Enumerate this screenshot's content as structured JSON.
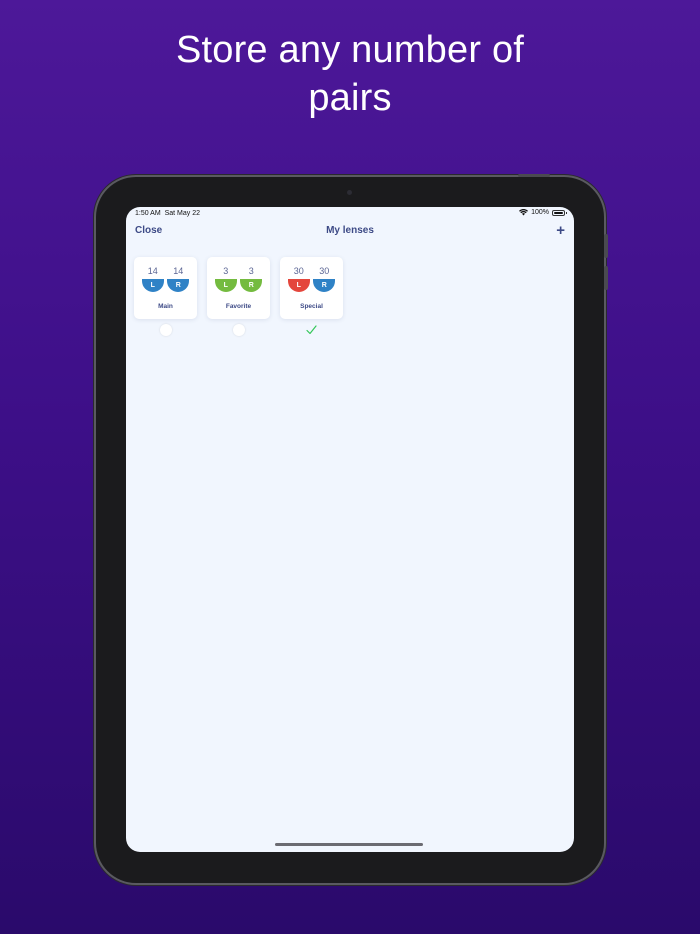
{
  "headline": {
    "line1": "Store any number of",
    "line2": "pairs"
  },
  "status_bar": {
    "time": "1:50 AM",
    "date": "Sat May 22",
    "battery": "100%",
    "wifi_icon": "wifi-icon",
    "battery_icon": "battery-icon"
  },
  "nav": {
    "close_label": "Close",
    "title": "My lenses",
    "add_label": "+"
  },
  "colors": {
    "blue_lens": "#2f82c6",
    "green_lens": "#74bb3f",
    "red_lens": "#e4463c",
    "text_navy": "#3d4a86",
    "check_green": "#34c759"
  },
  "pairs": [
    {
      "name": "Main",
      "left": {
        "count": "14",
        "letter": "L",
        "color": "#2f82c6"
      },
      "right": {
        "count": "14",
        "letter": "R",
        "color": "#2f82c6"
      },
      "selected": false
    },
    {
      "name": "Favorite",
      "left": {
        "count": "3",
        "letter": "L",
        "color": "#74bb3f"
      },
      "right": {
        "count": "3",
        "letter": "R",
        "color": "#74bb3f"
      },
      "selected": false
    },
    {
      "name": "Special",
      "left": {
        "count": "30",
        "letter": "L",
        "color": "#e4463c"
      },
      "right": {
        "count": "30",
        "letter": "R",
        "color": "#2f82c6"
      },
      "selected": true
    }
  ]
}
